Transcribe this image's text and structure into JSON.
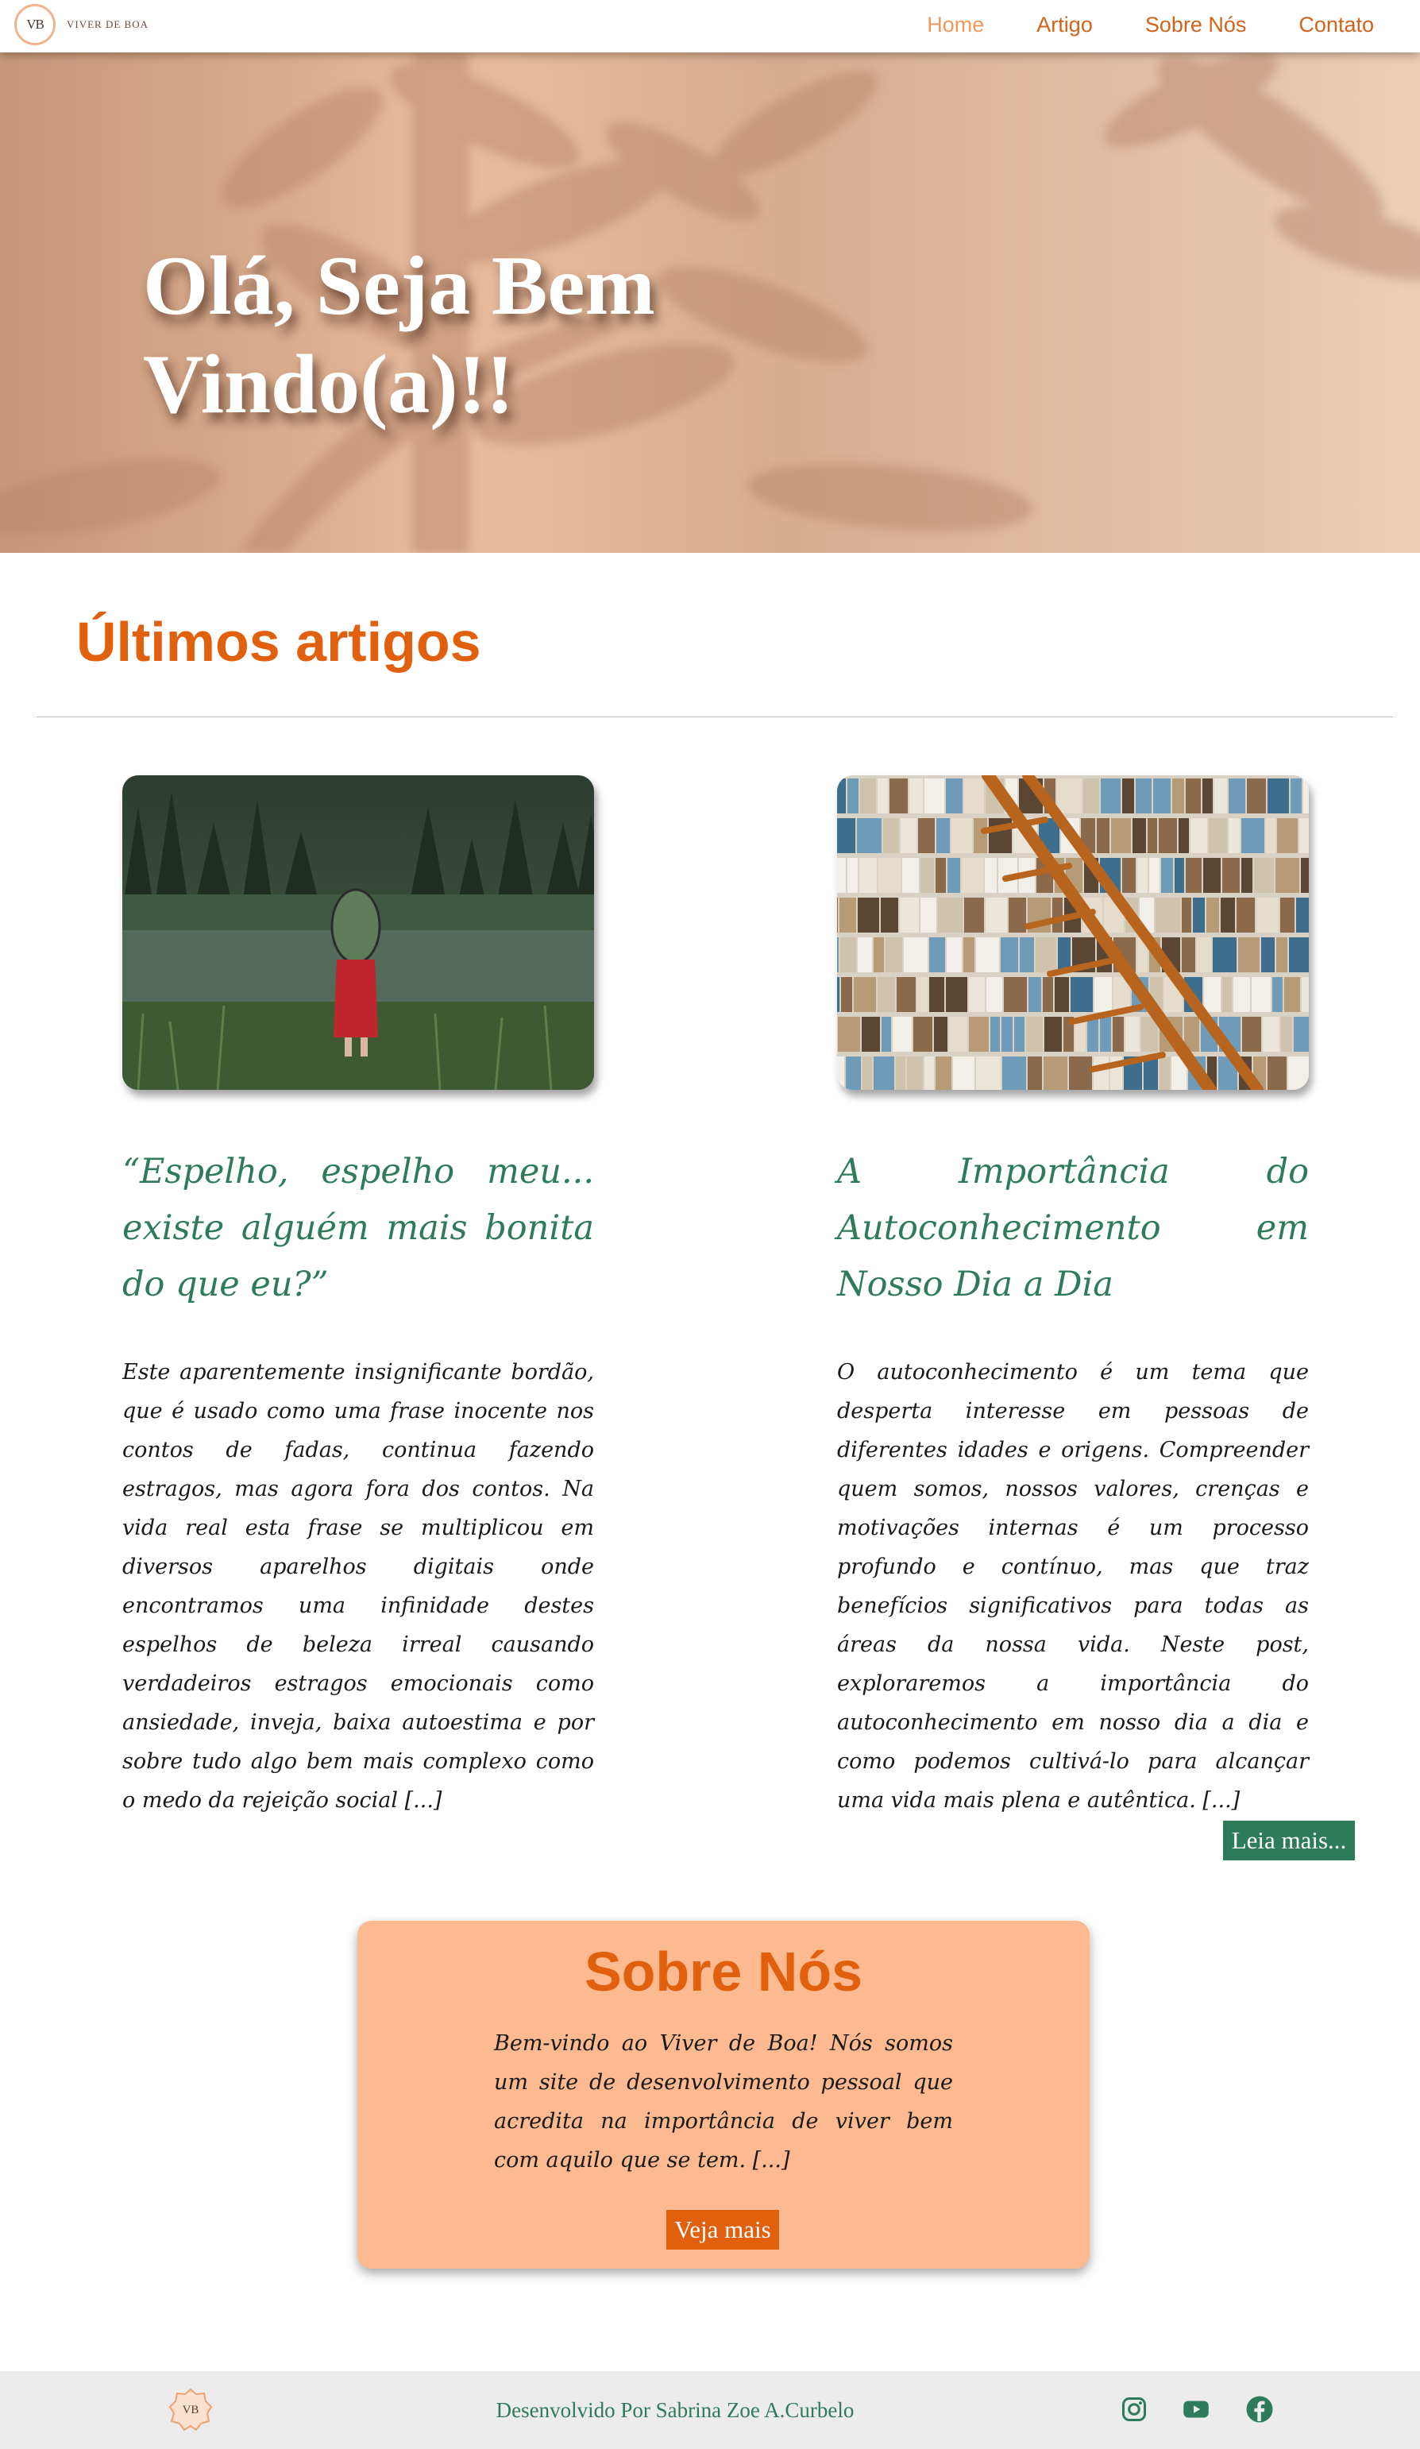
{
  "header": {
    "logo_text": "VB",
    "brand": "VIVER DE BOA",
    "nav": [
      "Home",
      "Artigo",
      "Sobre Nós",
      "Contato"
    ]
  },
  "hero": {
    "title_line1": "Olá, Seja Bem",
    "title_line2": "Vindo(a)!!"
  },
  "articles": {
    "section_title": "Últimos artigos",
    "items": [
      {
        "title": "“Espelho, espelho meu... existe alguém mais bonita do que eu?”",
        "excerpt": "Este aparentemente insignificante bordão, que é usado como uma frase inocente nos contos de fadas, continua fazendo estragos, mas agora fora dos contos. Na vida real esta frase se multiplicou em diversos aparelhos digitais onde encontramos uma infinidade destes espelhos de beleza irreal causando verdadeiros estragos emocionais como ansiedade, inveja, baixa autoestima e por sobre tudo algo bem mais complexo como o medo da rejeição social [...]",
        "image_icon": "woman-with-mirror-image"
      },
      {
        "title": "A Importância do Autoconhecimento em Nosso Dia a Dia",
        "excerpt": "O autoconhecimento é um tema que desperta interesse em pessoas de diferentes idades e origens. Compreender quem somos, nossos valores, crenças e motivações internas é um processo profundo e contínuo, mas que traz benefícios significativos para todas as áreas da nossa vida. Neste post, exploraremos a importância do autoconhecimento em nosso dia a dia e como podemos cultivá-lo para alcançar uma vida mais plena e autêntica. [...]",
        "image_icon": "bookshelf-ladder-image"
      }
    ],
    "read_more": "Leia mais..."
  },
  "about": {
    "title": "Sobre Nós",
    "text": "Bem-vindo ao Viver de Boa! Nós somos um site de desenvolvimento pessoal que acredita na importância de viver bem com aquilo que se tem. [...]",
    "button": "Veja mais"
  },
  "footer": {
    "logo_text": "VB",
    "credit": "Desenvolvido Por Sabrina Zoe A.Curbelo",
    "social": [
      "instagram-icon",
      "youtube-icon",
      "facebook-icon"
    ]
  },
  "colors": {
    "accent_orange": "#e0600e",
    "nav_active": "#f09a5a",
    "green": "#2e7b5c",
    "about_bg": "#fdb98f",
    "footer_bg": "#ececec"
  }
}
